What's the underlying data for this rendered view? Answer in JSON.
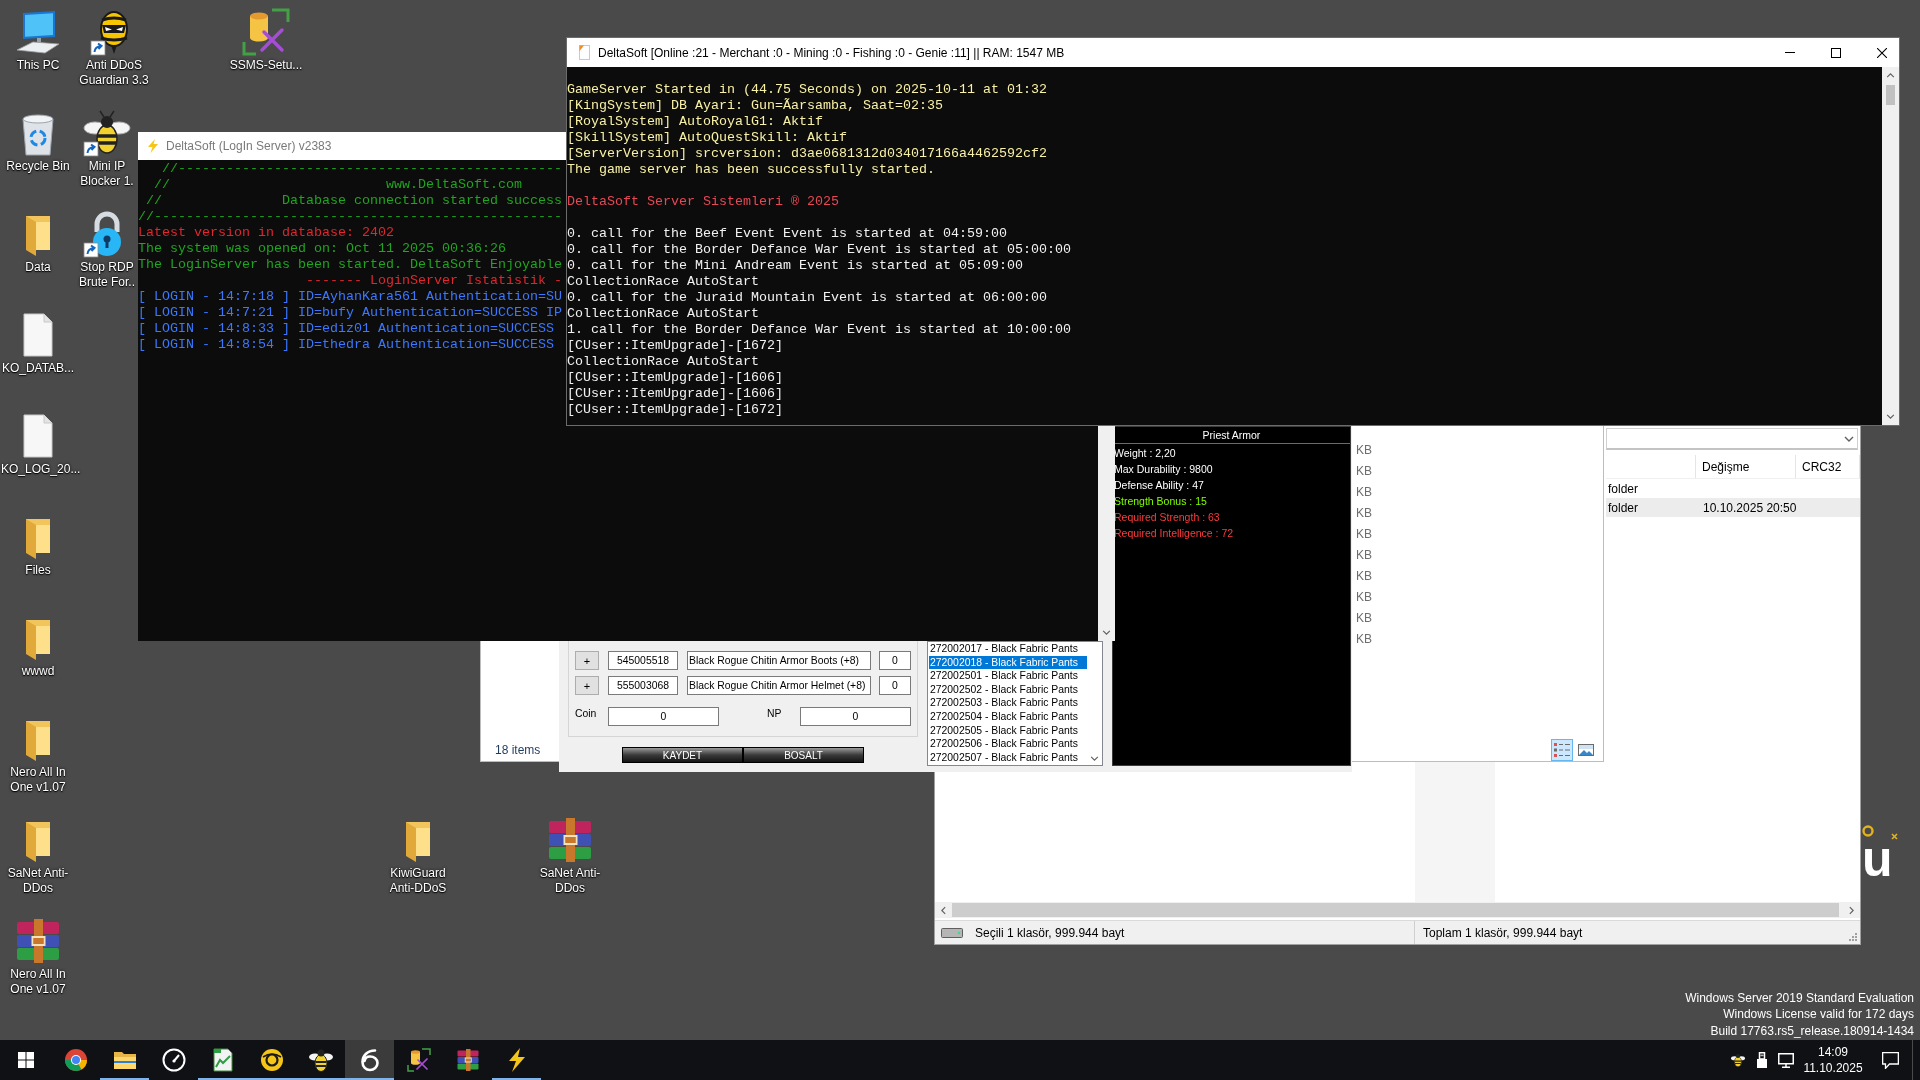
{
  "desktop": {
    "icons": [
      {
        "label": "This PC",
        "kind": "computer",
        "shortcut": false
      },
      {
        "label": "Anti DDoS Guardian 3.3",
        "kind": "hornet",
        "shortcut": true
      },
      {
        "label": "SSMS-Setu...",
        "kind": "installer",
        "shortcut": false
      },
      {
        "label": "Recycle Bin",
        "kind": "trash",
        "shortcut": false
      },
      {
        "label": "Mini IP Blocker 1.",
        "kind": "bee",
        "shortcut": true
      },
      {
        "label": "Data",
        "kind": "folder",
        "shortcut": false
      },
      {
        "label": "Stop RDP Brute For..",
        "kind": "padlock",
        "shortcut": true
      },
      {
        "label": "KO_DATAB...",
        "kind": "document",
        "shortcut": false
      },
      {
        "label": "KO_LOG_20...",
        "kind": "document",
        "shortcut": false
      },
      {
        "label": "Files",
        "kind": "folder",
        "shortcut": false
      },
      {
        "label": "wwwd",
        "kind": "folder",
        "shortcut": false
      },
      {
        "label": "Nero All In One v1.07",
        "kind": "folder",
        "shortcut": false
      },
      {
        "label": "SaNet Anti-DDos",
        "kind": "folder",
        "shortcut": false
      },
      {
        "label": "KiwiGuard Anti-DDoS",
        "kind": "folder",
        "shortcut": false
      },
      {
        "label": "SaNet Anti-DDos",
        "kind": "archive",
        "shortcut": false
      },
      {
        "label": "Nero All In One v1.07",
        "kind": "archive",
        "shortcut": false
      }
    ],
    "logo_mark": "u",
    "edition": [
      "Windows Server 2019 Standard Evaluation",
      "Windows License valid for 172 days",
      "Build 17763.rs5_release.180914-1434"
    ]
  },
  "game_server_window": {
    "title": "DeltaSoft [Online :21 - Merchant :0 - Mining :0 - Fishing :0 - Genie :11] || RAM: 1547 MB",
    "blocks": [
      {
        "lines": [
          {
            "text": "GameServer Started in (44.75 Seconds) on 2025-10-11 at 01:32",
            "kind": "status"
          },
          {
            "text": "[KingSystem] DB Ayari: Gun=Ãarsamba, Saat=02:35",
            "kind": "status"
          },
          {
            "text": "[RoyalSystem] AutoRoyalG1: Aktif",
            "kind": "status"
          },
          {
            "text": "[SkillSystem] AutoQuestSkill: Aktif",
            "kind": "status"
          },
          {
            "text": "[ServerVersion] srcversion: d3ae0681312d034017166a4462592cf2",
            "kind": "status"
          },
          {
            "text": "The game server has been successfully started.",
            "kind": "status"
          }
        ]
      },
      {
        "lines": [
          {
            "text": "DeltaSoft Server Sistemleri ® 2025",
            "kind": "banner"
          }
        ]
      },
      {
        "lines": [
          {
            "text": "0. call for the Beef Event Event is started at 04:59:00",
            "kind": "log"
          },
          {
            "text": "0. call for the Border Defance War Event is started at 05:00:00",
            "kind": "log"
          },
          {
            "text": "0. call for the Mini Andream Event is started at 05:09:00",
            "kind": "log"
          },
          {
            "text": "CollectionRace AutoStart",
            "kind": "log"
          },
          {
            "text": "0. call for the Juraid Mountain Event is started at 06:00:00",
            "kind": "log"
          },
          {
            "text": "CollectionRace AutoStart",
            "kind": "log"
          },
          {
            "text": "1. call for the Border Defance War Event is started at 10:00:00",
            "kind": "log"
          },
          {
            "text": "[CUser::ItemUpgrade]-[1672]",
            "kind": "log"
          },
          {
            "text": "CollectionRace AutoStart",
            "kind": "log"
          },
          {
            "text": "[CUser::ItemUpgrade]-[1606]",
            "kind": "log"
          },
          {
            "text": "[CUser::ItemUpgrade]-[1606]",
            "kind": "log"
          },
          {
            "text": "[CUser::ItemUpgrade]-[1672]",
            "kind": "log"
          }
        ]
      }
    ]
  },
  "login_server_window": {
    "title": "DeltaSoft (LogIn Server) v2383",
    "lines": [
      {
        "text": "   //------------------------------------------------",
        "kind": "info"
      },
      {
        "text": "  //                           www.DeltaSoft.com",
        "kind": "info"
      },
      {
        "text": " //               Database connection started success",
        "kind": "info"
      },
      {
        "text": "//---------------------------------------------------",
        "kind": "info"
      },
      {
        "text": "Latest version in database: 2402",
        "kind": "alert"
      },
      {
        "text": "The system was opened on: Oct 11 2025 00:36:26",
        "kind": "info"
      },
      {
        "text": "The LoginServer has been started. DeltaSoft Enjoyable",
        "kind": "info"
      },
      {
        "text": "                     ------- LoginServer Istatistik -",
        "kind": "alert"
      },
      {
        "text": "[ LOGIN - 14:7:18 ] ID=AyhanKara561 Authentication=SU",
        "kind": "login"
      },
      {
        "text": "[ LOGIN - 14:7:21 ] ID=bufy Authentication=SUCCESS IP",
        "kind": "login"
      },
      {
        "text": "[ LOGIN - 14:8:33 ] ID=ediz01 Authentication=SUCCESS",
        "kind": "login"
      },
      {
        "text": "[ LOGIN - 14:8:54 ] ID=thedra Authentication=SUCCESS",
        "kind": "login"
      }
    ]
  },
  "item_editor": {
    "rows": [
      {
        "action": "+",
        "code": "545005518",
        "name": "Black Rogue Chitin Armor Boots (+8)",
        "count": "0"
      },
      {
        "action": "+",
        "code": "555003068",
        "name": "Black Rogue Chitin Armor Helmet (+8)",
        "count": "0"
      }
    ],
    "coin": {
      "label": "Coin",
      "value": "0"
    },
    "np": {
      "label": "NP",
      "value": "0"
    },
    "buttons": [
      "KAYDET",
      "BOSALT"
    ],
    "item_list": [
      {
        "text": "272002017 - Black Fabric Pants",
        "selected": false
      },
      {
        "text": "272002018 - Black Fabric Pants",
        "selected": true
      },
      {
        "text": "272002501 - Black Fabric Pants",
        "selected": false
      },
      {
        "text": "272002502 - Black Fabric Pants",
        "selected": false
      },
      {
        "text": "272002503 - Black Fabric Pants",
        "selected": false
      },
      {
        "text": "272002504 - Black Fabric Pants",
        "selected": false
      },
      {
        "text": "272002505 - Black Fabric Pants",
        "selected": false
      },
      {
        "text": "272002506 - Black Fabric Pants",
        "selected": false
      },
      {
        "text": "272002507 - Black Fabric Pants",
        "selected": false
      }
    ],
    "tooltip": {
      "title": "Priest Armor",
      "lines": [
        {
          "text": "Weight : 2,20",
          "kind": "stat"
        },
        {
          "text": "Max Durability : 9800",
          "kind": "stat"
        },
        {
          "text": "Defense Ability : 47",
          "kind": "stat"
        },
        {
          "text": "Strength Bonus : 15",
          "kind": "bonus"
        },
        {
          "text": "Required Strength : 63",
          "kind": "requirement"
        },
        {
          "text": "Required Intelligence : 72",
          "kind": "requirement"
        }
      ]
    }
  },
  "explorer_window": {
    "size_column": [
      "KB",
      "KB",
      "KB",
      "KB",
      "KB",
      "KB",
      "KB",
      "KB",
      "KB",
      "KB"
    ],
    "status": "18 items",
    "view_buttons": [
      {
        "kind": "details",
        "selected": true
      },
      {
        "kind": "thumbnails",
        "selected": false
      }
    ]
  },
  "archive_window": {
    "columns": [
      "Değişme",
      "CRC32"
    ],
    "rows": [
      {
        "type": "folder",
        "selected": false
      },
      {
        "type": "folder",
        "modified": "10.10.2025 20:50",
        "selected": true
      }
    ],
    "status": {
      "selection": "Seçili 1 klasör, 999.944 bayt",
      "total": "Toplam 1 klasör, 999.944 bayt"
    }
  },
  "taskbar": {
    "apps": [
      {
        "kind": "browser",
        "running": false,
        "selected": false
      },
      {
        "kind": "folder",
        "running": true,
        "selected": false
      },
      {
        "kind": "gauge",
        "running": false,
        "selected": false
      },
      {
        "kind": "notepad",
        "running": true,
        "selected": false
      },
      {
        "kind": "orb",
        "running": true,
        "selected": false
      },
      {
        "kind": "bee",
        "running": true,
        "selected": false
      },
      {
        "kind": "swirl",
        "running": true,
        "selected": true
      },
      {
        "kind": "installer",
        "running": false,
        "selected": false
      },
      {
        "kind": "archive",
        "running": false,
        "selected": false
      },
      {
        "kind": "lightning",
        "running": true,
        "selected": false
      }
    ],
    "clock": {
      "time": "14:09",
      "date": "11.10.2025"
    }
  }
}
